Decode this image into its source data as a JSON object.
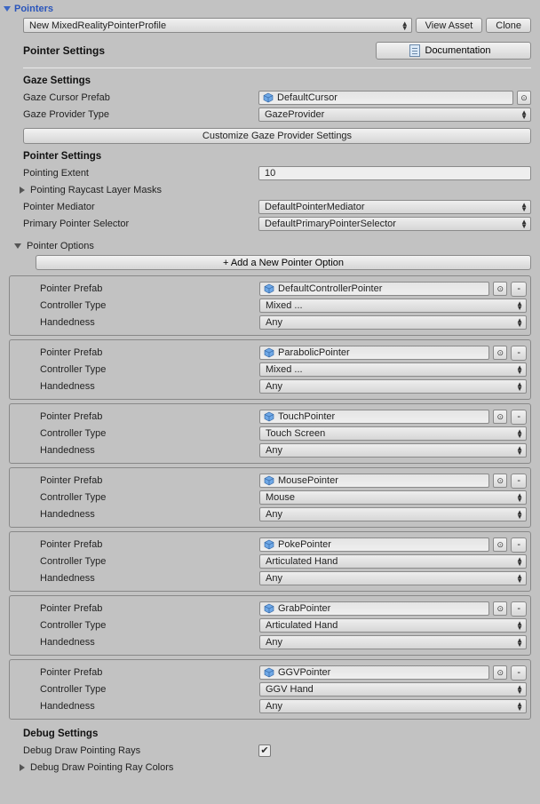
{
  "header": {
    "title": "Pointers"
  },
  "top": {
    "profile": "New MixedRealityPointerProfile",
    "view_asset": "View Asset",
    "clone": "Clone"
  },
  "band": {
    "title": "Pointer Settings",
    "documentation": "Documentation"
  },
  "gaze": {
    "heading": "Gaze Settings",
    "cursor_label": "Gaze Cursor Prefab",
    "cursor_value": "DefaultCursor",
    "provider_label": "Gaze Provider Type",
    "provider_value": "GazeProvider",
    "customize_button": "Customize Gaze Provider Settings"
  },
  "pointer_settings": {
    "heading": "Pointer Settings",
    "extent_label": "Pointing Extent",
    "extent_value": "10",
    "raycast_foldout": "Pointing Raycast Layer Masks",
    "mediator_label": "Pointer Mediator",
    "mediator_value": "DefaultPointerMediator",
    "selector_label": "Primary Pointer Selector",
    "selector_value": "DefaultPrimaryPointerSelector"
  },
  "options": {
    "foldout": "Pointer Options",
    "add_button": "+ Add a New Pointer Option",
    "labels": {
      "prefab": "Pointer Prefab",
      "controller": "Controller Type",
      "hand": "Handedness",
      "remove": "-"
    },
    "items": [
      {
        "prefab": "DefaultControllerPointer",
        "controller": "Mixed ...",
        "hand": "Any"
      },
      {
        "prefab": "ParabolicPointer",
        "controller": "Mixed ...",
        "hand": "Any"
      },
      {
        "prefab": "TouchPointer",
        "controller": "Touch Screen",
        "hand": "Any"
      },
      {
        "prefab": "MousePointer",
        "controller": "Mouse",
        "hand": "Any"
      },
      {
        "prefab": "PokePointer",
        "controller": "Articulated Hand",
        "hand": "Any"
      },
      {
        "prefab": "GrabPointer",
        "controller": "Articulated Hand",
        "hand": "Any"
      },
      {
        "prefab": "GGVPointer",
        "controller": "GGV Hand",
        "hand": "Any"
      }
    ]
  },
  "debug": {
    "heading": "Debug Settings",
    "draw_rays_label": "Debug Draw Pointing Rays",
    "draw_rays_checked": true,
    "colors_foldout": "Debug Draw Pointing Ray Colors"
  }
}
